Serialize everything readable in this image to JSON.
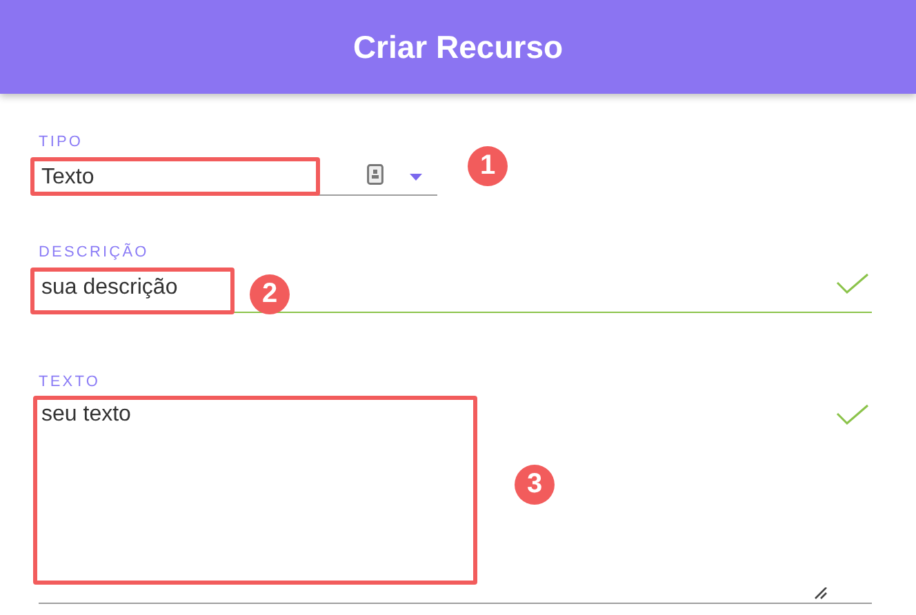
{
  "header": {
    "title": "Criar Recurso"
  },
  "fields": [
    {
      "kind": "select",
      "label": "TIPO",
      "value": "Texto",
      "valid": false,
      "callout": "1"
    },
    {
      "kind": "input",
      "label": "DESCRIÇÃO",
      "value": "sua descrição",
      "valid": true,
      "callout": "2"
    },
    {
      "kind": "textarea",
      "label": "TEXTO",
      "value": "seu texto",
      "valid": true,
      "callout": "3"
    }
  ]
}
